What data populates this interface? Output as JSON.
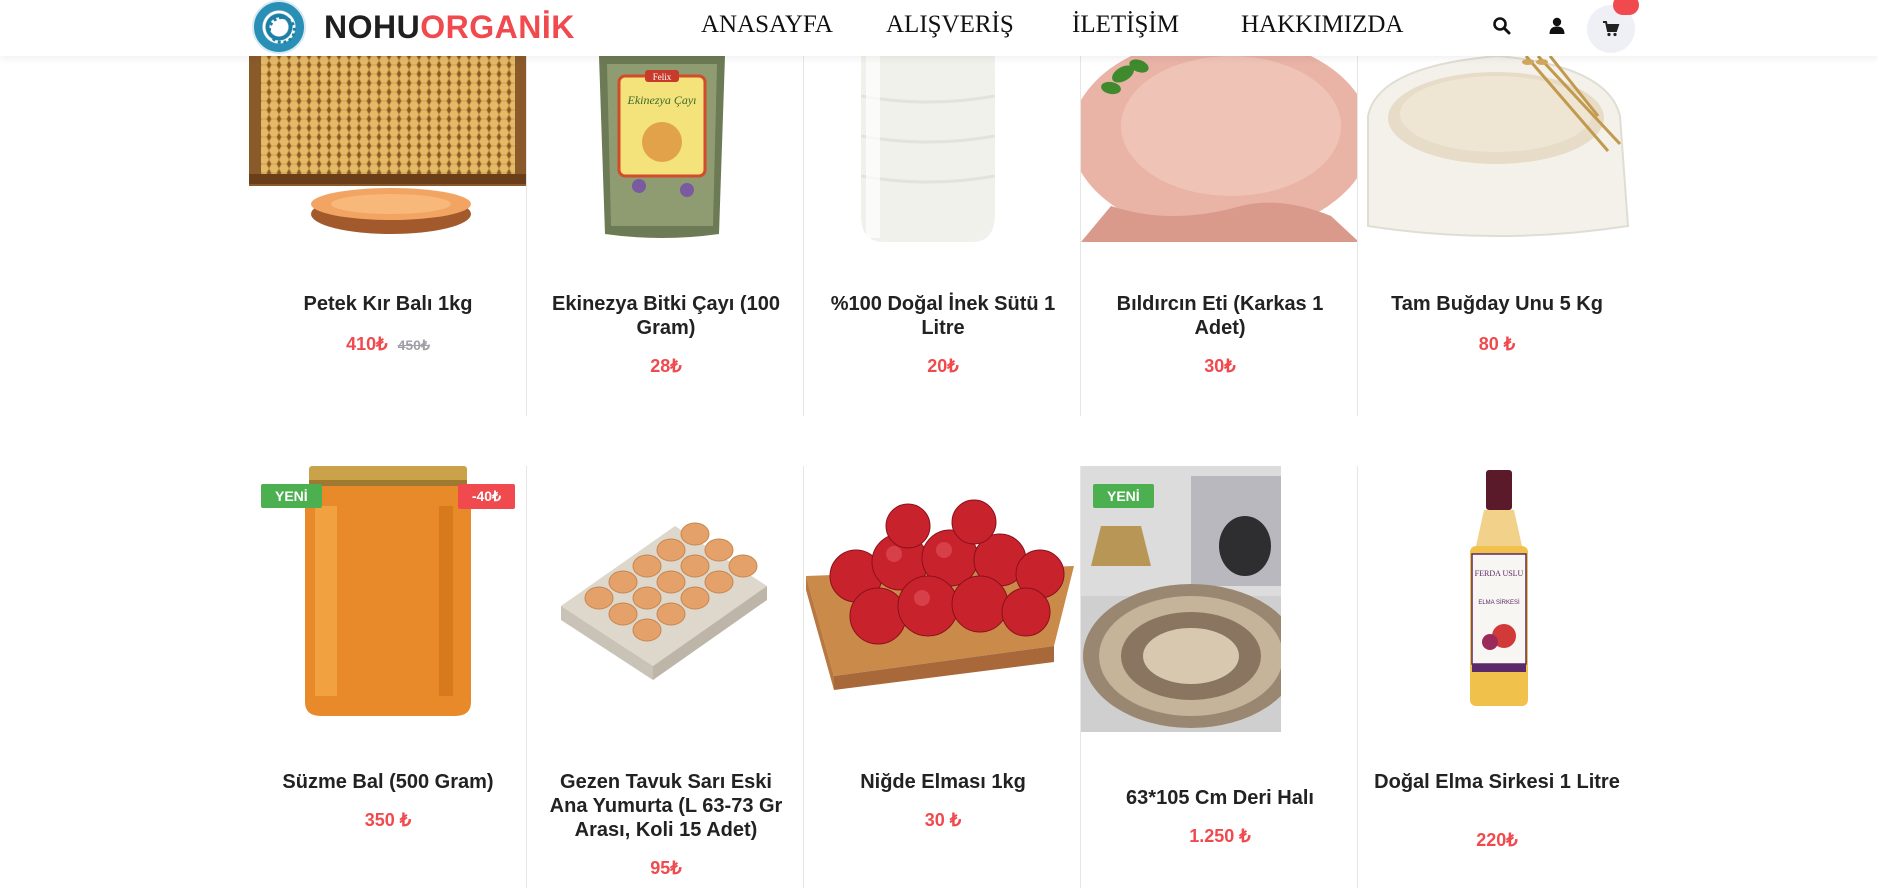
{
  "brand": {
    "part1": "NOHU",
    "part2": "ORGANİK"
  },
  "nav": [
    {
      "label": "ANASAYFA"
    },
    {
      "label": "ALIŞVERİŞ"
    },
    {
      "label": "İLETİŞİM"
    },
    {
      "label": "HAKKIMIZDA"
    }
  ],
  "colors": {
    "accent": "#f04a4e",
    "new_badge": "#4caf50",
    "text": "#222222"
  },
  "icons": [
    "search-icon",
    "user-icon",
    "cart-icon"
  ],
  "products": [
    {
      "name": "Petek Kır Balı 1kg",
      "price": "410₺",
      "old_price": "450₺"
    },
    {
      "name": "Ekinezya Bitki Çayı (100 Gram)",
      "price": "28₺"
    },
    {
      "name": "%100 Doğal İnek Sütü 1 Litre",
      "price": "20₺"
    },
    {
      "name": "Bıldırcın Eti (Karkas 1 Adet)",
      "price": "30₺"
    },
    {
      "name": "Tam Buğday Unu 5 Kg",
      "price": "80 ₺"
    },
    {
      "name": "Süzme Bal (500 Gram)",
      "price": "350 ₺",
      "badge_new": "YENİ",
      "badge_discount": "-40₺"
    },
    {
      "name": "Gezen Tavuk Sarı Eski Ana Yumurta (L 63-73 Gr Arası, Koli 15 Adet)",
      "price": "95₺"
    },
    {
      "name": "Niğde Elması 1kg",
      "price": "30 ₺"
    },
    {
      "name": "63*105 Cm Deri Halı",
      "price": "1.250 ₺",
      "badge_new": "YENİ"
    },
    {
      "name": "Doğal Elma Sirkesi 1 Litre",
      "price": "220₺"
    }
  ],
  "packaging": {
    "tea_brand": "Felix",
    "tea_label": "Ekinezya Çayı",
    "vinegar_brand": "FERDA USLU",
    "vinegar_label": "ELMA SİRKESİ"
  }
}
